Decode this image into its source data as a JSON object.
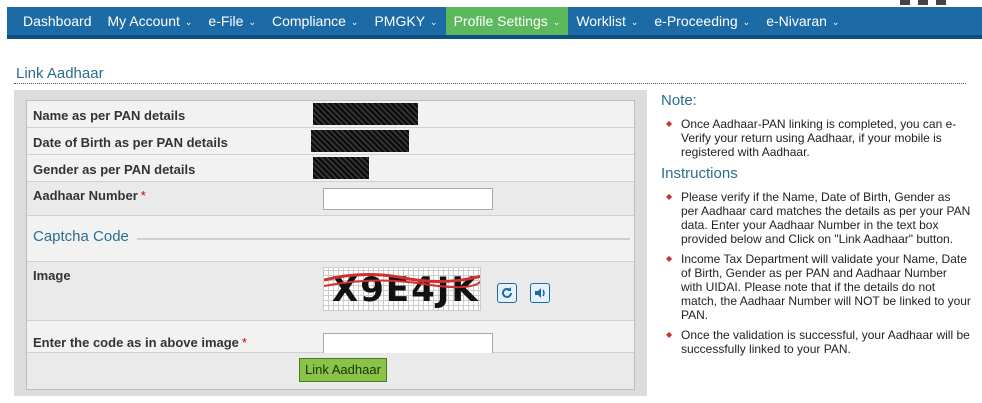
{
  "nav": {
    "items": [
      {
        "label": "Dashboard",
        "caret": ""
      },
      {
        "label": "My Account",
        "caret": "⌄"
      },
      {
        "label": "e-File",
        "caret": "⌄"
      },
      {
        "label": "Compliance",
        "caret": "⌄"
      },
      {
        "label": "PMGKY",
        "caret": "⌄"
      },
      {
        "label": "Profile Settings",
        "caret": "⌄"
      },
      {
        "label": "Worklist",
        "caret": "⌄"
      },
      {
        "label": "e-Proceeding",
        "caret": "⌄"
      },
      {
        "label": "e-Nivaran",
        "caret": "⌄"
      }
    ],
    "active_index": 5,
    "colors": {
      "bar": "#1d6ba6",
      "active": "#5cb85c"
    }
  },
  "page": {
    "title": "Link Aadhaar"
  },
  "form": {
    "name_label": "Name as per PAN details",
    "dob_label": "Date of Birth as per PAN details",
    "gender_label": "Gender as per PAN details",
    "aadhaar_label": "Aadhaar Number",
    "required_mark": "*",
    "aadhaar_value": "",
    "captcha_section": "Captcha Code",
    "image_label": "Image",
    "captcha_text": "X9E4JK",
    "code_label": "Enter the code as in above image",
    "code_value": "",
    "submit_label": "Link Aadhaar"
  },
  "side": {
    "note_title": "Note:",
    "notes": [
      "Once Aadhaar-PAN linking is completed, you can e-Verify your return using Aadhaar, if your mobile is registered with Aadhaar."
    ],
    "instructions_title": "Instructions",
    "instructions": [
      "Please verify if the Name, Date of Birth, Gender as per Aadhaar card matches the details as per your PAN data. Enter your Aadhaar Number in the text box provided below and Click on \"Link Aadhaar\" button.",
      "Income Tax Department will validate your Name, Date of Birth, Gender as per PAN and Aadhaar Number with UIDAI. Please note that if the details do not match, the Aadhaar Number will NOT be linked to your PAN.",
      "Once the validation is successful, your Aadhaar will be successfully linked to your PAN."
    ]
  },
  "icons": {
    "refresh": "refresh-icon",
    "audio": "speaker-icon",
    "bullet": "diamond-bullet-icon"
  }
}
